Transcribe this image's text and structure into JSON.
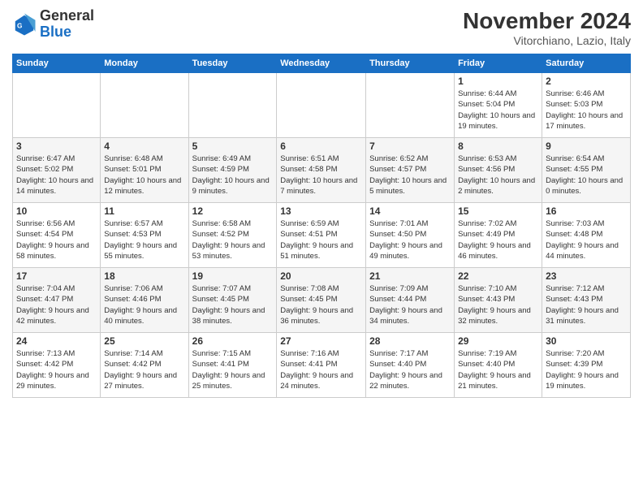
{
  "header": {
    "logo_general": "General",
    "logo_blue": "Blue",
    "month_title": "November 2024",
    "location": "Vitorchiano, Lazio, Italy"
  },
  "days_of_week": [
    "Sunday",
    "Monday",
    "Tuesday",
    "Wednesday",
    "Thursday",
    "Friday",
    "Saturday"
  ],
  "weeks": [
    [
      {
        "day": "",
        "info": ""
      },
      {
        "day": "",
        "info": ""
      },
      {
        "day": "",
        "info": ""
      },
      {
        "day": "",
        "info": ""
      },
      {
        "day": "",
        "info": ""
      },
      {
        "day": "1",
        "info": "Sunrise: 6:44 AM\nSunset: 5:04 PM\nDaylight: 10 hours and 19 minutes."
      },
      {
        "day": "2",
        "info": "Sunrise: 6:46 AM\nSunset: 5:03 PM\nDaylight: 10 hours and 17 minutes."
      }
    ],
    [
      {
        "day": "3",
        "info": "Sunrise: 6:47 AM\nSunset: 5:02 PM\nDaylight: 10 hours and 14 minutes."
      },
      {
        "day": "4",
        "info": "Sunrise: 6:48 AM\nSunset: 5:01 PM\nDaylight: 10 hours and 12 minutes."
      },
      {
        "day": "5",
        "info": "Sunrise: 6:49 AM\nSunset: 4:59 PM\nDaylight: 10 hours and 9 minutes."
      },
      {
        "day": "6",
        "info": "Sunrise: 6:51 AM\nSunset: 4:58 PM\nDaylight: 10 hours and 7 minutes."
      },
      {
        "day": "7",
        "info": "Sunrise: 6:52 AM\nSunset: 4:57 PM\nDaylight: 10 hours and 5 minutes."
      },
      {
        "day": "8",
        "info": "Sunrise: 6:53 AM\nSunset: 4:56 PM\nDaylight: 10 hours and 2 minutes."
      },
      {
        "day": "9",
        "info": "Sunrise: 6:54 AM\nSunset: 4:55 PM\nDaylight: 10 hours and 0 minutes."
      }
    ],
    [
      {
        "day": "10",
        "info": "Sunrise: 6:56 AM\nSunset: 4:54 PM\nDaylight: 9 hours and 58 minutes."
      },
      {
        "day": "11",
        "info": "Sunrise: 6:57 AM\nSunset: 4:53 PM\nDaylight: 9 hours and 55 minutes."
      },
      {
        "day": "12",
        "info": "Sunrise: 6:58 AM\nSunset: 4:52 PM\nDaylight: 9 hours and 53 minutes."
      },
      {
        "day": "13",
        "info": "Sunrise: 6:59 AM\nSunset: 4:51 PM\nDaylight: 9 hours and 51 minutes."
      },
      {
        "day": "14",
        "info": "Sunrise: 7:01 AM\nSunset: 4:50 PM\nDaylight: 9 hours and 49 minutes."
      },
      {
        "day": "15",
        "info": "Sunrise: 7:02 AM\nSunset: 4:49 PM\nDaylight: 9 hours and 46 minutes."
      },
      {
        "day": "16",
        "info": "Sunrise: 7:03 AM\nSunset: 4:48 PM\nDaylight: 9 hours and 44 minutes."
      }
    ],
    [
      {
        "day": "17",
        "info": "Sunrise: 7:04 AM\nSunset: 4:47 PM\nDaylight: 9 hours and 42 minutes."
      },
      {
        "day": "18",
        "info": "Sunrise: 7:06 AM\nSunset: 4:46 PM\nDaylight: 9 hours and 40 minutes."
      },
      {
        "day": "19",
        "info": "Sunrise: 7:07 AM\nSunset: 4:45 PM\nDaylight: 9 hours and 38 minutes."
      },
      {
        "day": "20",
        "info": "Sunrise: 7:08 AM\nSunset: 4:45 PM\nDaylight: 9 hours and 36 minutes."
      },
      {
        "day": "21",
        "info": "Sunrise: 7:09 AM\nSunset: 4:44 PM\nDaylight: 9 hours and 34 minutes."
      },
      {
        "day": "22",
        "info": "Sunrise: 7:10 AM\nSunset: 4:43 PM\nDaylight: 9 hours and 32 minutes."
      },
      {
        "day": "23",
        "info": "Sunrise: 7:12 AM\nSunset: 4:43 PM\nDaylight: 9 hours and 31 minutes."
      }
    ],
    [
      {
        "day": "24",
        "info": "Sunrise: 7:13 AM\nSunset: 4:42 PM\nDaylight: 9 hours and 29 minutes."
      },
      {
        "day": "25",
        "info": "Sunrise: 7:14 AM\nSunset: 4:42 PM\nDaylight: 9 hours and 27 minutes."
      },
      {
        "day": "26",
        "info": "Sunrise: 7:15 AM\nSunset: 4:41 PM\nDaylight: 9 hours and 25 minutes."
      },
      {
        "day": "27",
        "info": "Sunrise: 7:16 AM\nSunset: 4:41 PM\nDaylight: 9 hours and 24 minutes."
      },
      {
        "day": "28",
        "info": "Sunrise: 7:17 AM\nSunset: 4:40 PM\nDaylight: 9 hours and 22 minutes."
      },
      {
        "day": "29",
        "info": "Sunrise: 7:19 AM\nSunset: 4:40 PM\nDaylight: 9 hours and 21 minutes."
      },
      {
        "day": "30",
        "info": "Sunrise: 7:20 AM\nSunset: 4:39 PM\nDaylight: 9 hours and 19 minutes."
      }
    ]
  ]
}
